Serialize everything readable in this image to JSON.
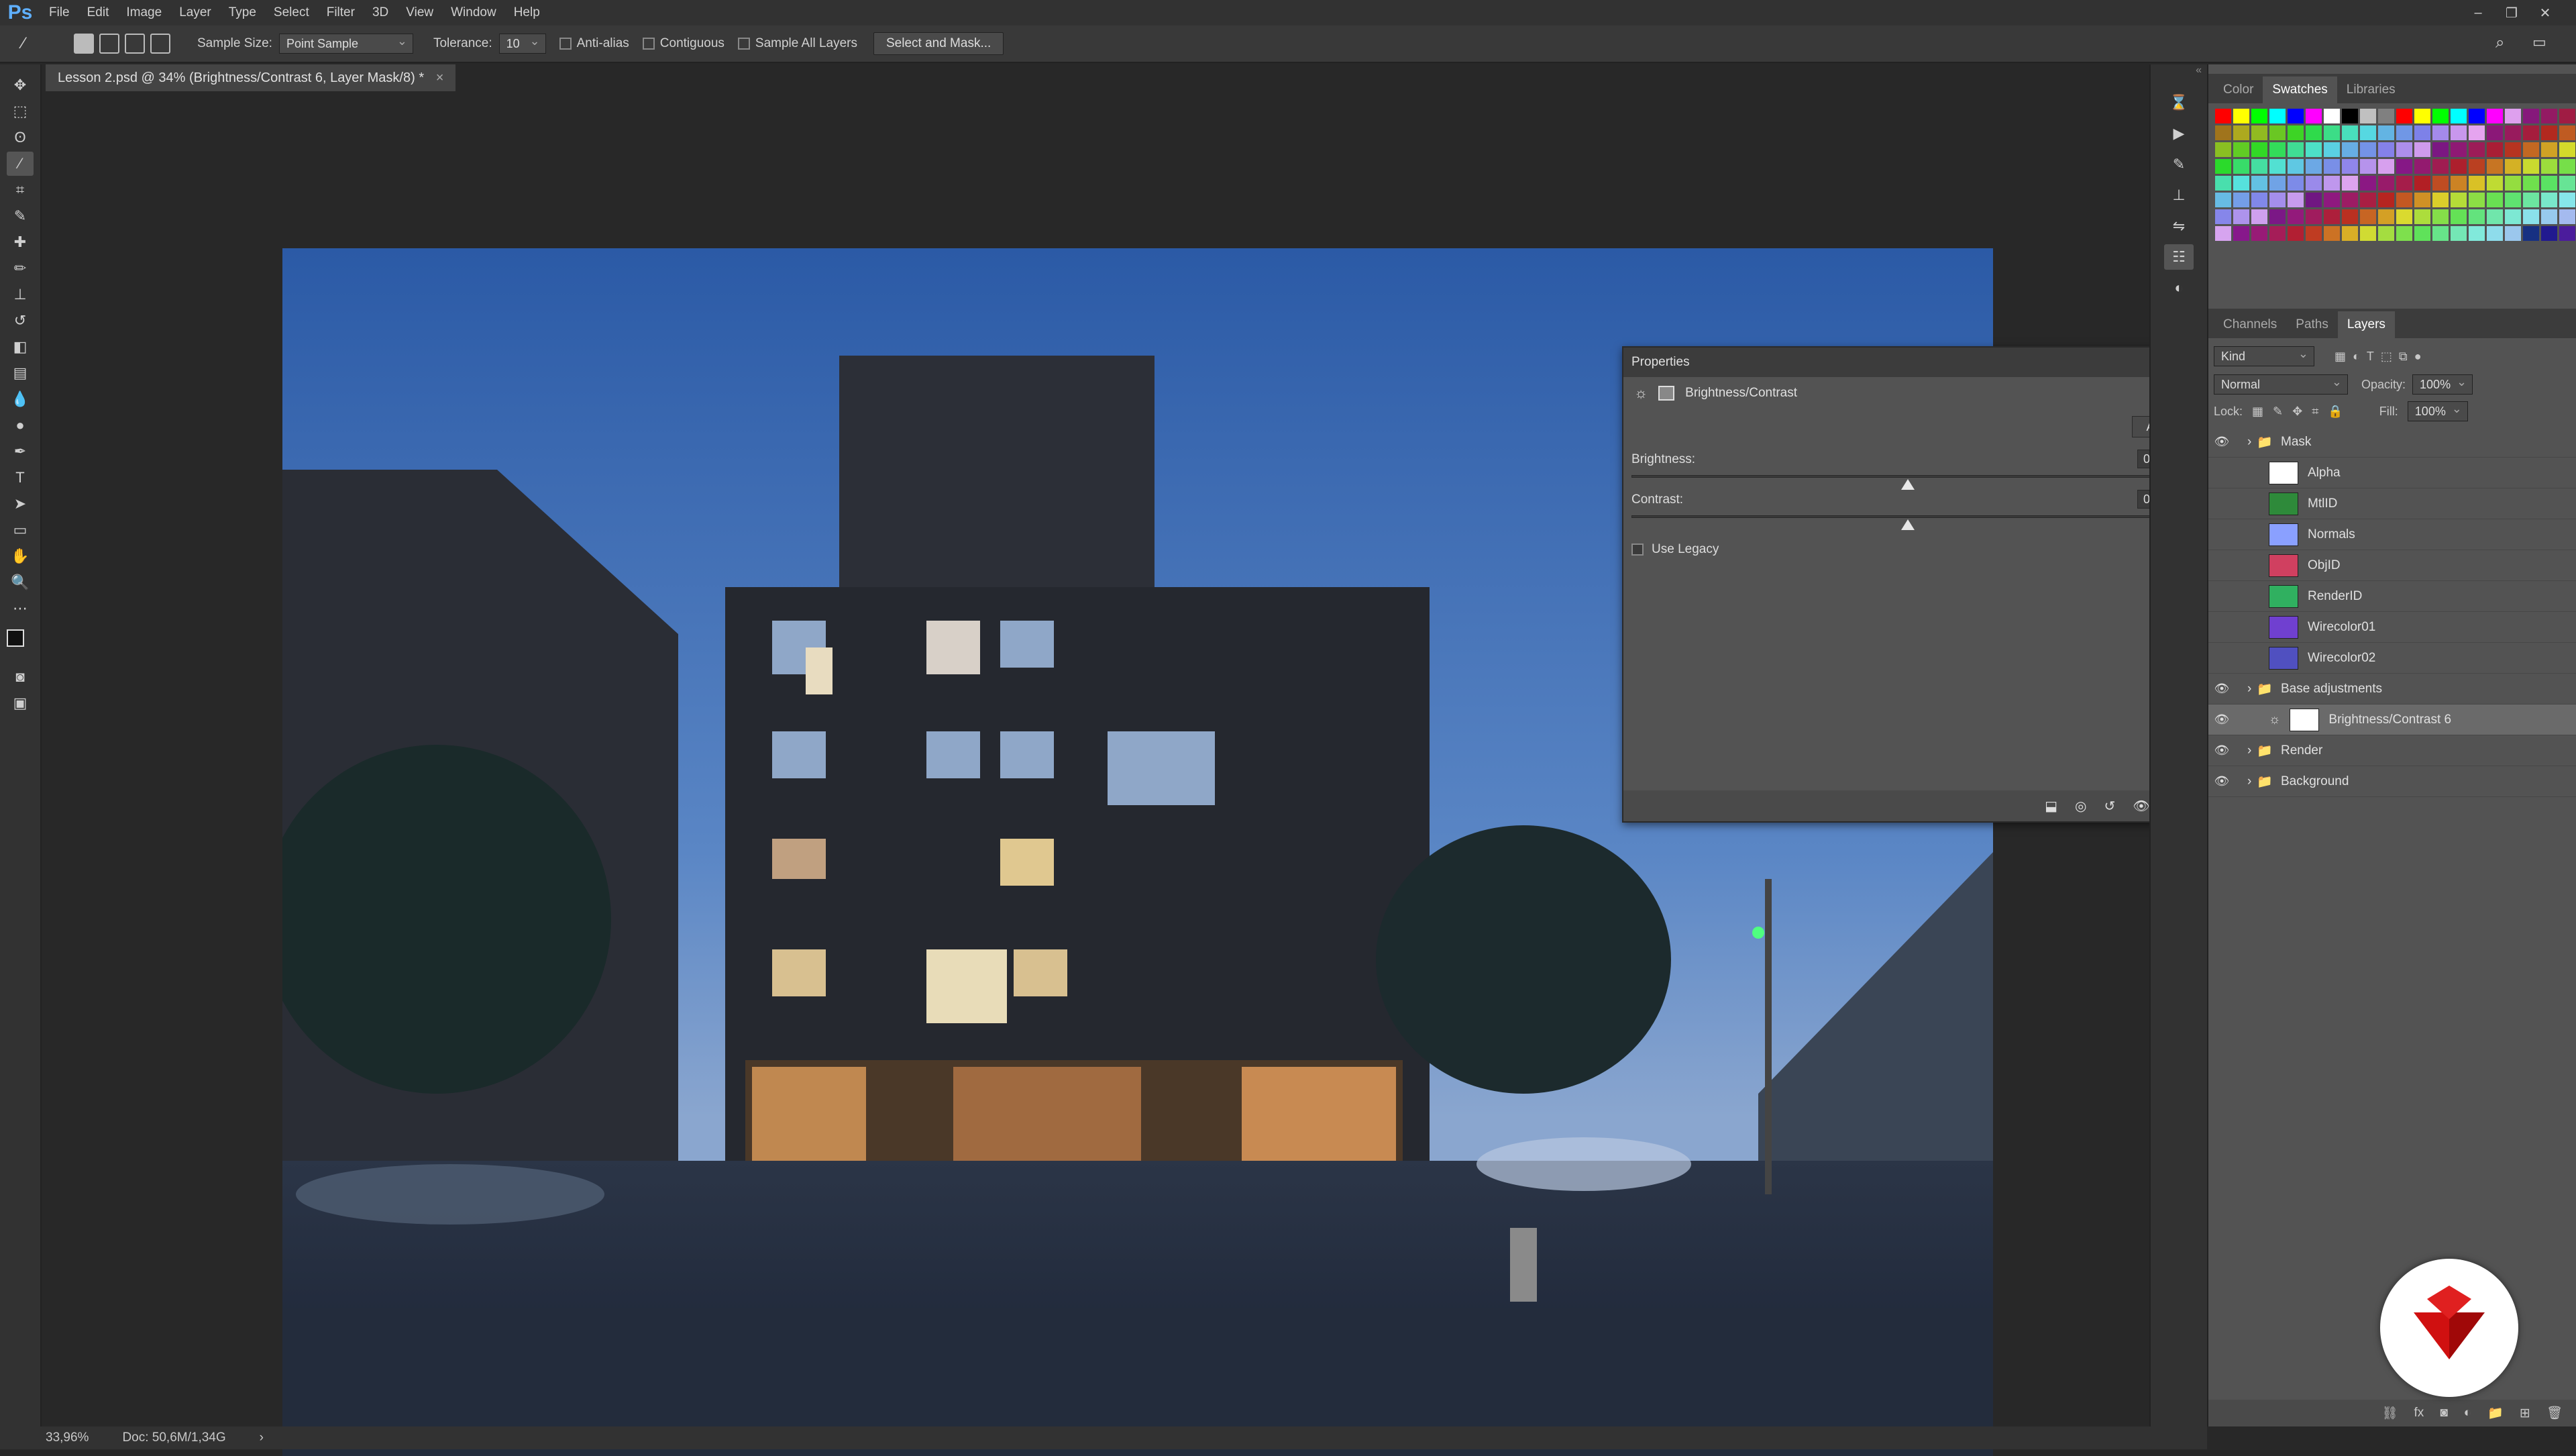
{
  "app": {
    "logo": "Ps"
  },
  "menubar": [
    "File",
    "Edit",
    "Image",
    "Layer",
    "Type",
    "Select",
    "Filter",
    "3D",
    "View",
    "Window",
    "Help"
  ],
  "options": {
    "sample_size_label": "Sample Size:",
    "sample_size_value": "Point Sample",
    "tolerance_label": "Tolerance:",
    "tolerance_value": "10",
    "anti_alias": "Anti-alias",
    "contiguous": "Contiguous",
    "sample_all_layers": "Sample All Layers",
    "select_mask_button": "Select and Mask..."
  },
  "document_tab": {
    "title": "Lesson 2.psd @ 34% (Brightness/Contrast 6, Layer Mask/8) *",
    "close": "×"
  },
  "properties": {
    "title": "Properties",
    "adjustment_name": "Brightness/Contrast",
    "auto_label": "Auto",
    "brightness_label": "Brightness:",
    "brightness_value": "0",
    "contrast_label": "Contrast:",
    "contrast_value": "0",
    "use_legacy": "Use Legacy"
  },
  "swatch_tabs": [
    "Color",
    "Swatches",
    "Libraries"
  ],
  "layer_tabs": [
    "Channels",
    "Paths",
    "Layers"
  ],
  "layers_controls": {
    "kind": "Kind",
    "blend_mode": "Normal",
    "opacity_label": "Opacity:",
    "opacity_value": "100%",
    "lock_label": "Lock:",
    "fill_label": "Fill:",
    "fill_value": "100%"
  },
  "layers": [
    {
      "name": "Mask",
      "type": "group",
      "visible": true
    },
    {
      "name": "Alpha",
      "type": "layer",
      "visible": false,
      "thumb": "#ffffff"
    },
    {
      "name": "MtlID",
      "type": "layer",
      "visible": false,
      "thumb": "#2e8a3a"
    },
    {
      "name": "Normals",
      "type": "layer",
      "visible": false,
      "thumb": "#8aa0ff"
    },
    {
      "name": "ObjID",
      "type": "layer",
      "visible": false,
      "thumb": "#d04060"
    },
    {
      "name": "RenderID",
      "type": "layer",
      "visible": false,
      "thumb": "#30b060"
    },
    {
      "name": "Wirecolor01",
      "type": "layer",
      "visible": false,
      "thumb": "#7040d0"
    },
    {
      "name": "Wirecolor02",
      "type": "layer",
      "visible": false,
      "thumb": "#5050c0"
    },
    {
      "name": "Base adjustments",
      "type": "group",
      "visible": true
    },
    {
      "name": "Brightness/Contrast 6",
      "type": "adjustment",
      "visible": true,
      "selected": true
    },
    {
      "name": "Render",
      "type": "group",
      "visible": true
    },
    {
      "name": "Background",
      "type": "group",
      "visible": true
    }
  ],
  "status": {
    "zoom": "33,96%",
    "doc": "Doc: 50,6M/1,34G",
    "arrow": "›"
  },
  "colors": {
    "accent": "#5fb0ff",
    "panel": "#535353",
    "brand_logo": "#d01010"
  }
}
